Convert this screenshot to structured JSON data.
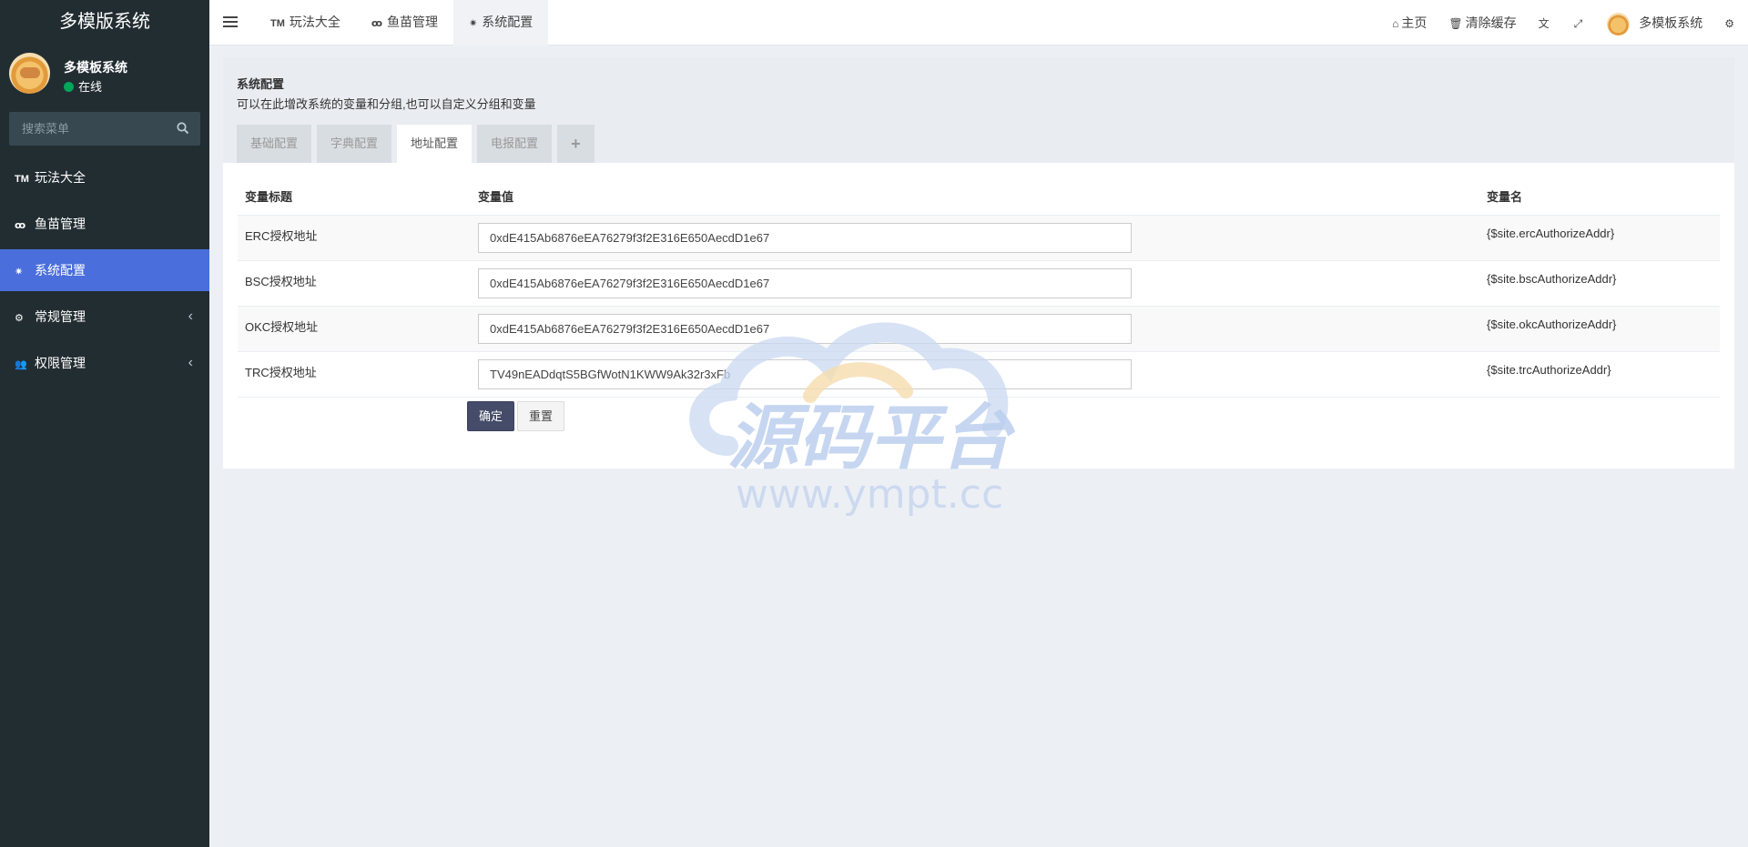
{
  "sidebar": {
    "logo": "多模版系统",
    "user_name": "多模板系统",
    "status": "在线",
    "search_placeholder": "搜索菜单",
    "items": [
      {
        "icon": "TM",
        "label": "玩法大全"
      },
      {
        "icon": "ꝏ",
        "label": "鱼苗管理"
      },
      {
        "icon": "✷",
        "label": "系统配置"
      },
      {
        "icon": "⚙",
        "label": "常规管理",
        "chevron": "‹"
      },
      {
        "icon": "👥",
        "label": "权限管理",
        "chevron": "‹"
      }
    ]
  },
  "header": {
    "tabs": [
      {
        "icon": "TM",
        "label": "玩法大全"
      },
      {
        "icon": "ꝏ",
        "label": "鱼苗管理"
      },
      {
        "icon": "✷",
        "label": "系统配置"
      }
    ],
    "home": "主页",
    "clear_cache": "清除缓存",
    "user_name": "多模板系统"
  },
  "panel": {
    "title": "系统配置",
    "description": "可以在此增改系统的变量和分组,也可以自定义分组和变量",
    "tabs": [
      "基础配置",
      "字典配置",
      "地址配置",
      "电报配置",
      "+"
    ]
  },
  "table": {
    "headers": [
      "变量标题",
      "变量值",
      "变量名"
    ],
    "rows": [
      {
        "title": "ERC授权地址",
        "value": "0xdE415Ab6876eEA76279f3f2E316E650AecdD1e67",
        "name": "{$site.ercAuthorizeAddr}"
      },
      {
        "title": "BSC授权地址",
        "value": "0xdE415Ab6876eEA76279f3f2E316E650AecdD1e67",
        "name": "{$site.bscAuthorizeAddr}"
      },
      {
        "title": "OKC授权地址",
        "value": "0xdE415Ab6876eEA76279f3f2E316E650AecdD1e67",
        "name": "{$site.okcAuthorizeAddr}"
      },
      {
        "title": "TRC授权地址",
        "value": "TV49nEADdqtS5BGfWotN1KWW9Ak32r3xFb",
        "name": "{$site.trcAuthorizeAddr}"
      }
    ]
  },
  "buttons": {
    "submit": "确定",
    "reset": "重置"
  },
  "watermark": {
    "text": "源码平台",
    "url": "www.ympt.cc"
  },
  "colors": {
    "sidebar_bg": "#222d32",
    "active_menu": "#4a6fdc",
    "primary_button": "#444c69",
    "online": "#00a65a"
  }
}
